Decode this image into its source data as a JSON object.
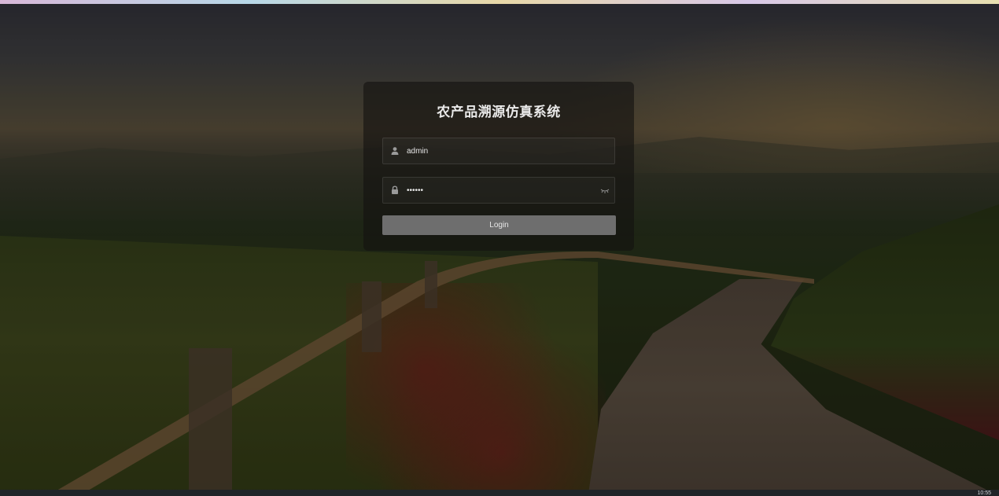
{
  "login": {
    "title": "农产品溯源仿真系统",
    "username_value": "admin",
    "password_value": "••••••",
    "button_label": "Login"
  },
  "icons": {
    "username": "user-icon",
    "password": "lock-icon",
    "toggle_password": "eye-closed-icon"
  },
  "taskbar": {
    "clock": "10:55"
  }
}
